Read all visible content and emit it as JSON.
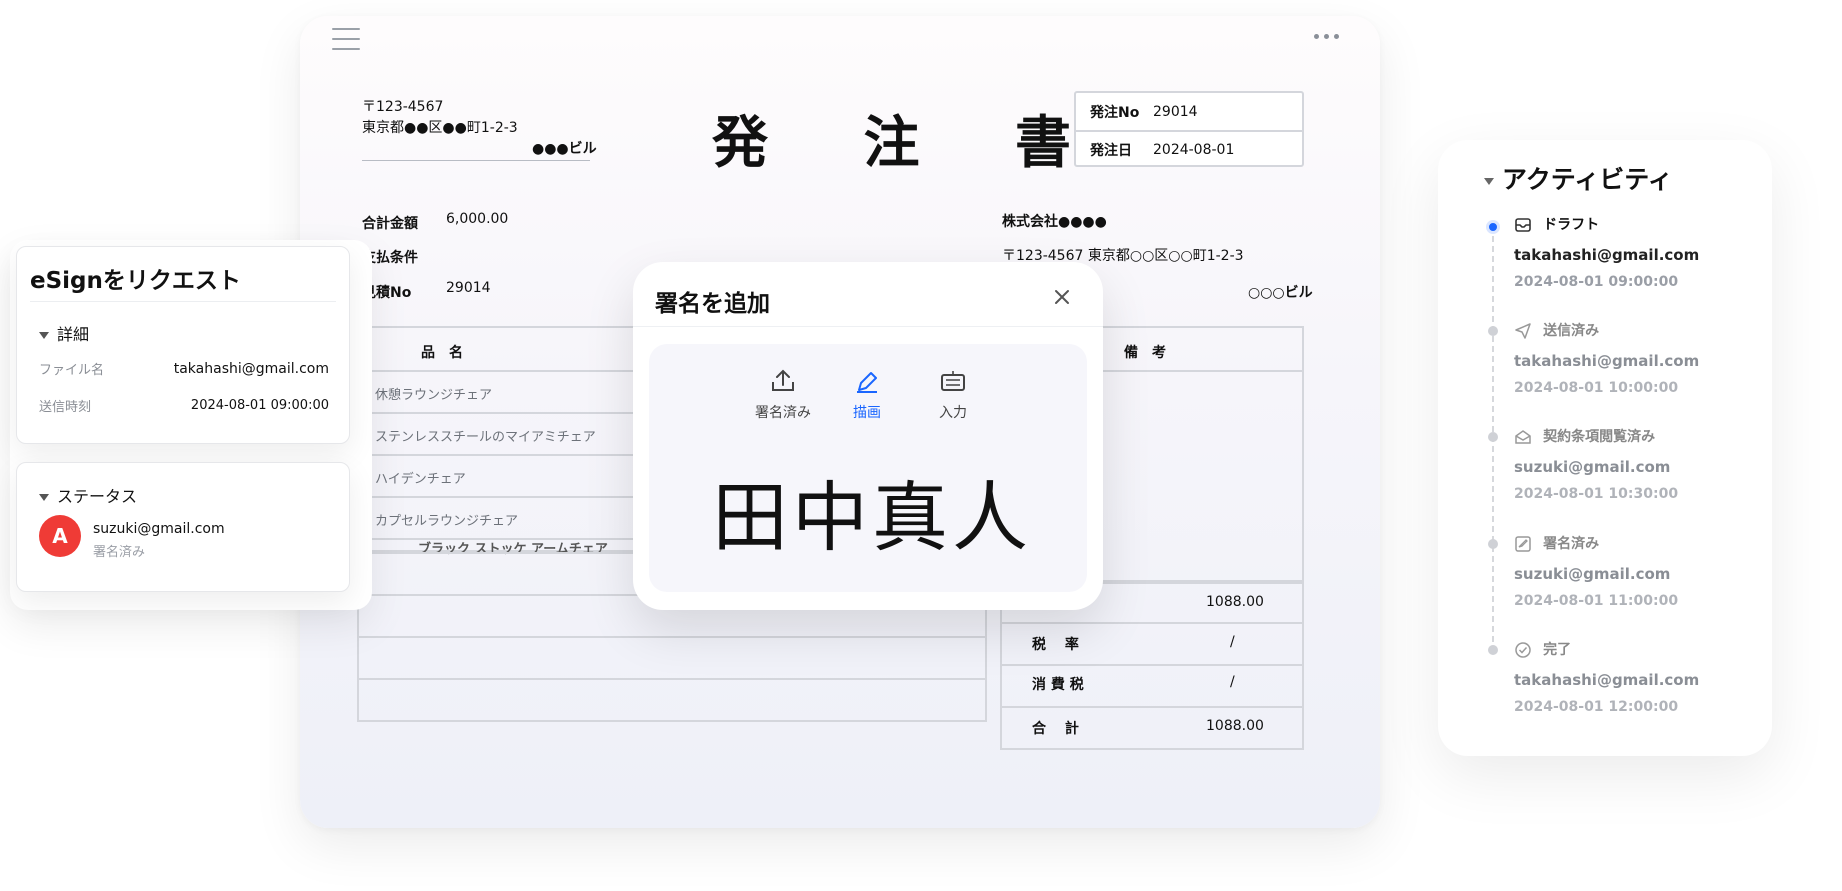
{
  "document": {
    "postal": "〒123-4567",
    "address": "東京都●●区●●町1-2-3",
    "building": "●●●ビル",
    "title": "発 注 書",
    "order_no_label": "発注No",
    "order_no": "29014",
    "order_date_label": "発注日",
    "order_date": "2024-08-01",
    "total_label": "合計金額",
    "total": "6,000.00",
    "payment_label": "支払条件",
    "quote_label": "見積No",
    "quote_no": "29014",
    "company": "株式会社●●●●",
    "company_address": "〒123-4567 東京都○○区○○町1-2-3",
    "company_building": "○○○ビル",
    "col_item": "品　名",
    "col_note": "備　考",
    "items": [
      "休憩ラウンジチェア",
      "ステンレススチールのマイアミチェア",
      "ハイデンチェア",
      "カプセルラウンジチェア",
      "ブラック ストッケ アームチェア"
    ],
    "summary": [
      {
        "label": "",
        "value": "1088.00"
      },
      {
        "label": "税　 率",
        "value": "/"
      },
      {
        "label": "消 費 税",
        "value": "/"
      },
      {
        "label": "合　 計",
        "value": "1088.00"
      }
    ]
  },
  "esign": {
    "title": "eSignをリクエスト",
    "details_label": "詳細",
    "file_label": "ファイル名",
    "file_value": "takahashi@gmail.com",
    "sent_label": "送信時刻",
    "sent_value": "2024-08-01 09:00:00",
    "status_label": "ステータス",
    "avatar_letter": "A",
    "status_email": "suzuki@gmail.com",
    "status_text": "署名済み"
  },
  "signature_dialog": {
    "title": "署名を追加",
    "tabs": [
      {
        "label": "署名済み",
        "icon": "upload-icon",
        "active": false
      },
      {
        "label": "描画",
        "icon": "pen-icon",
        "active": true
      },
      {
        "label": "入力",
        "icon": "keyboard-icon",
        "active": false
      }
    ],
    "signature_text": "田中真人"
  },
  "activity": {
    "title": "アクティビティ",
    "events": [
      {
        "label": "ドラフト",
        "icon": "inbox-icon",
        "email": "takahashi@gmail.com",
        "time": "2024-08-01 09:00:00",
        "active": true
      },
      {
        "label": "送信済み",
        "icon": "send-icon",
        "email": "takahashi@gmail.com",
        "time": "2024-08-01 10:00:00",
        "active": false
      },
      {
        "label": "契約条項閲覧済み",
        "icon": "envelope-open-icon",
        "email": "suzuki@gmail.com",
        "time": "2024-08-01 10:30:00",
        "active": false
      },
      {
        "label": "署名済み",
        "icon": "sign-icon",
        "email": "suzuki@gmail.com",
        "time": "2024-08-01 11:00:00",
        "active": false
      },
      {
        "label": "完了",
        "icon": "check-circle-icon",
        "email": "takahashi@gmail.com",
        "time": "2024-08-01 12:00:00",
        "active": false
      }
    ]
  },
  "colors": {
    "accent": "#1a66ff",
    "avatar": "#ef3b36",
    "active_dot": "#1a66ff",
    "inactive_dot": "#cfd1d6"
  }
}
